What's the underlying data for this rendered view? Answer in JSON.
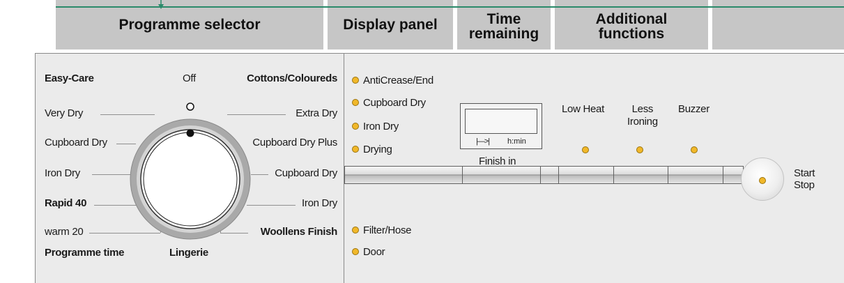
{
  "headers": {
    "programme_selector": "Programme selector",
    "display_panel": "Display panel",
    "time_remaining": [
      "Time",
      "remaining"
    ],
    "additional_functions": [
      "Additional",
      "functions"
    ]
  },
  "dial": {
    "top_left": "Easy-Care",
    "top": "Off",
    "top_right": "Cottons/Coloureds",
    "left": [
      "Very Dry",
      "Cupboard Dry",
      "Iron Dry",
      "Rapid 40",
      "warm 20"
    ],
    "right": [
      "Extra Dry",
      "Cupboard Dry Plus",
      "Cupboard Dry",
      "Iron Dry",
      "Woollens Finish"
    ],
    "bottom_left": "Programme time",
    "bottom": "Lingerie"
  },
  "indicators": {
    "upper": [
      "AntiCrease/End",
      "Cupboard Dry",
      "Iron Dry",
      "Drying"
    ],
    "lower": [
      "Filter/Hose",
      "Door"
    ]
  },
  "display": {
    "icon_label": "|—>|",
    "unit": "h:min",
    "finish_in": "Finish in"
  },
  "functions": {
    "low_heat": "Low Heat",
    "less_ironing": [
      "Less",
      "Ironing"
    ],
    "buzzer": "Buzzer"
  },
  "start_stop": [
    "Start",
    "Stop"
  ],
  "colors": {
    "header_bg": "#c6c6c6",
    "panel_bg": "#ebebeb",
    "led": "#f1b82a",
    "top_line": "#2a8a6a"
  }
}
